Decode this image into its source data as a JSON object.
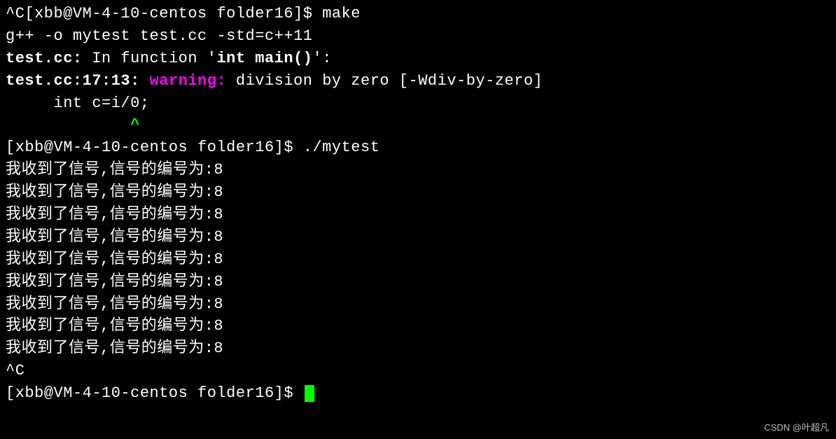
{
  "line1": {
    "interrupt": "^C",
    "prompt": "[xbb@VM-4-10-centos folder16]$ ",
    "cmd": "make"
  },
  "line2": "g++ -o mytest test.cc -std=c++11",
  "line3": {
    "file": "test.cc:",
    "mid": " In function '",
    "fn": "int main()",
    "end": "':"
  },
  "line4": {
    "loc": "test.cc:17:13: ",
    "warn": "warning: ",
    "msg": "division by zero [-Wdiv-by-zero]"
  },
  "line5": "     int c=i/0;",
  "line6": "             ",
  "caret": "^",
  "line7": {
    "prompt": "[xbb@VM-4-10-centos folder16]$ ",
    "cmd": "./mytest"
  },
  "output_line": "我收到了信号,信号的编号为:8",
  "interrupt2": "^C",
  "final_prompt": "[xbb@VM-4-10-centos folder16]$ ",
  "watermark": "CSDN @叶超凡"
}
